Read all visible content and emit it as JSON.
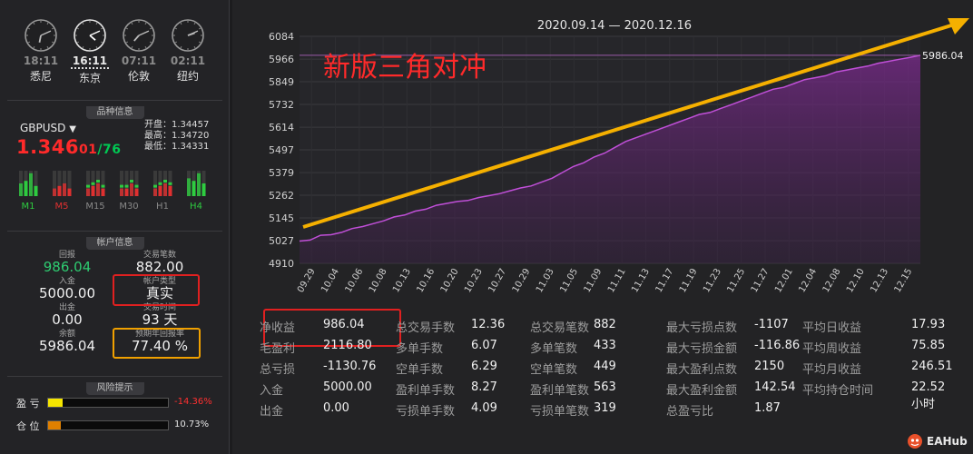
{
  "clocks": [
    {
      "time": "18:11",
      "city": "悉尼",
      "active": false,
      "h": 6.18,
      "m": 11
    },
    {
      "time": "16:11",
      "city": "东京",
      "active": true,
      "h": 4.18,
      "m": 11
    },
    {
      "time": "07:11",
      "city": "伦敦",
      "active": false,
      "h": 7.18,
      "m": 11
    },
    {
      "time": "02:11",
      "city": "纽约",
      "active": false,
      "h": 2.18,
      "m": 11
    }
  ],
  "sections": {
    "instrument": "品种信息",
    "account": "帐户信息",
    "risk": "风险提示"
  },
  "instrument": {
    "symbol": "GBPUSD",
    "caret": "▼",
    "price_main": "1.346",
    "price_mid": "01",
    "price_sep": "/",
    "price_tail": "76",
    "open": "开盘：1.34457",
    "high": "最高：1.34720",
    "low": "最低：1.34331"
  },
  "timeframes": [
    {
      "label": "M1",
      "color": "#2ecc40",
      "levels": [
        0.5,
        0.6,
        0.9,
        0.4
      ]
    },
    {
      "label": "M5",
      "color": "#e03030",
      "levels": [
        0.3,
        0.4,
        0.5,
        0.3
      ]
    },
    {
      "label": "M15",
      "color": "#888888",
      "levels": [
        0.3,
        0.4,
        0.5,
        0.3
      ]
    },
    {
      "label": "M30",
      "color": "#888888",
      "levels": [
        0.3,
        0.3,
        0.5,
        0.3
      ]
    },
    {
      "label": "H1",
      "color": "#888888",
      "levels": [
        0.3,
        0.4,
        0.5,
        0.4
      ]
    },
    {
      "label": "H4",
      "color": "#2ecc40",
      "levels": [
        0.7,
        0.6,
        0.9,
        0.5
      ]
    }
  ],
  "account": {
    "return_label": "回报",
    "return_value": "986.04",
    "trades_label": "交易笔数",
    "trades_value": "882.00",
    "deposit_label": "入金",
    "deposit_value": "5000.00",
    "type_label": "帐户类型",
    "type_value": "真实",
    "withdraw_label": "出金",
    "withdraw_value": "0.00",
    "time_label": "交易时间",
    "time_value": "93 天",
    "balance_label": "余额",
    "balance_value": "5986.04",
    "annual_label": "预期年回报率",
    "annual_value": "77.40 %"
  },
  "risk": [
    {
      "label": "盈 亏",
      "value": "-14.36%",
      "color": "#ff3030",
      "fill": "#f5e500",
      "level": 0.12
    },
    {
      "label": "仓 位",
      "value": "10.73%",
      "color": "#e6e6e6",
      "fill": "#e08000",
      "level": 0.1073
    }
  ],
  "chart_data": {
    "type": "area",
    "title": "2020.09.14 — 2020.12.16",
    "annotation": "新版三角对冲",
    "last_label": "5986.04",
    "yticks": [
      "6084",
      "5966",
      "5849",
      "5732",
      "5614",
      "5497",
      "5379",
      "5262",
      "5145",
      "5027",
      "4910"
    ],
    "ylim": [
      4910,
      6084
    ],
    "xticks": [
      "09.29",
      "10.04",
      "10.06",
      "10.08",
      "10.13",
      "10.16",
      "10.20",
      "10.23",
      "10.27",
      "10.29",
      "11.03",
      "11.05",
      "11.09",
      "11.11",
      "11.13",
      "11.17",
      "11.19",
      "11.23",
      "11.25",
      "11.27",
      "12.01",
      "12.04",
      "12.08",
      "12.10",
      "12.13",
      "12.15"
    ],
    "series": [
      {
        "values": [
          5025,
          5030,
          5055,
          5058,
          5070,
          5090,
          5100,
          5115,
          5130,
          5150,
          5160,
          5180,
          5190,
          5210,
          5220,
          5230,
          5235,
          5250,
          5260,
          5270,
          5285,
          5300,
          5310,
          5330,
          5350,
          5380,
          5410,
          5430,
          5460,
          5480,
          5510,
          5540,
          5560,
          5580,
          5600,
          5620,
          5640,
          5660,
          5680,
          5690,
          5710,
          5730,
          5750,
          5770,
          5790,
          5810,
          5820,
          5840,
          5860,
          5870,
          5880,
          5900,
          5910,
          5920,
          5930,
          5945,
          5955,
          5965,
          5975,
          5986.04
        ]
      }
    ]
  },
  "stats": [
    [
      [
        "净收益",
        "986.04"
      ],
      [
        "毛盈利",
        "2116.80"
      ],
      [
        "总亏损",
        "-1130.76"
      ],
      [
        "入金",
        "5000.00"
      ],
      [
        "出金",
        "0.00"
      ]
    ],
    [
      [
        "总交易手数",
        "12.36"
      ],
      [
        "多单手数",
        "6.07"
      ],
      [
        "空单手数",
        "6.29"
      ],
      [
        "盈利单手数",
        "8.27"
      ],
      [
        "亏损单手数",
        "4.09"
      ]
    ],
    [
      [
        "总交易笔数",
        "882"
      ],
      [
        "多单笔数",
        "433"
      ],
      [
        "空单笔数",
        "449"
      ],
      [
        "盈利单笔数",
        "563"
      ],
      [
        "亏损单笔数",
        "319"
      ]
    ],
    [
      [
        "最大亏损点数",
        "-1107"
      ],
      [
        "最大亏损金额",
        "-116.86"
      ],
      [
        "最大盈利点数",
        "2150"
      ],
      [
        "最大盈利金额",
        "142.54"
      ],
      [
        "总盈亏比",
        "1.87"
      ]
    ],
    [
      [
        "平均日收益",
        "17.93"
      ],
      [
        "平均周收益",
        "75.85"
      ],
      [
        "平均月收益",
        "246.51"
      ],
      [
        "平均持仓时间",
        "22.52小时"
      ]
    ]
  ],
  "logo": "EAHub"
}
